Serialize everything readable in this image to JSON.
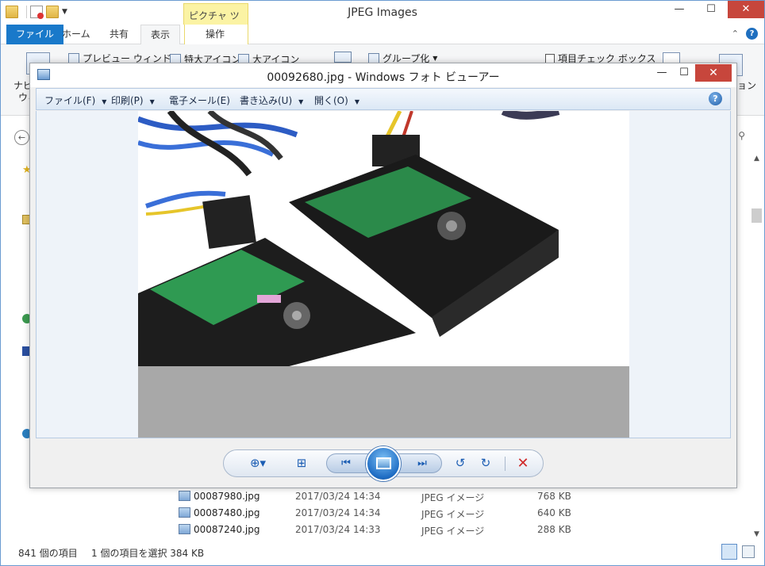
{
  "explorer": {
    "title": "JPEG Images",
    "picture_tools_label": "ピクチャ ツール",
    "window_controls": {
      "minimize": "—",
      "maximize": "☐",
      "close": "✕"
    },
    "tabs": {
      "file": "ファイル",
      "home": "ホーム",
      "share": "共有",
      "view": "表示",
      "manage": "操作"
    },
    "ribbon": {
      "nav_pane_line1": "ナビ",
      "nav_pane_line2": "ウィ",
      "preview_pane": "プレビュー ウィンドウ",
      "extra_large_icons": "特大アイコン",
      "large_icons": "大アイコン",
      "group_by": "グループ化",
      "item_check_boxes": "項目チェック ボックス",
      "options_partial": "ョン"
    },
    "files": [
      {
        "name": "00087980.jpg",
        "date": "2017/03/24 14:34",
        "type": "JPEG イメージ",
        "size": "768 KB"
      },
      {
        "name": "00087480.jpg",
        "date": "2017/03/24 14:34",
        "type": "JPEG イメージ",
        "size": "640 KB"
      },
      {
        "name": "00087240.jpg",
        "date": "2017/03/24 14:33",
        "type": "JPEG イメージ",
        "size": "288 KB"
      }
    ],
    "status": {
      "item_count": "841 個の項目",
      "selection": "1 個の項目を選択  384 KB"
    }
  },
  "viewer": {
    "title": "00092680.jpg - Windows フォト ビューアー",
    "window_controls": {
      "minimize": "—",
      "maximize": "☐",
      "close": "✕"
    },
    "menu": {
      "file": "ファイル(F)",
      "print": "印刷(P)",
      "email": "電子メール(E)",
      "burn": "書き込み(U)",
      "open": "開く(O)"
    },
    "help": "?",
    "colors": {
      "close_red": "#c7463c",
      "accent_blue": "#1b5db3",
      "delete_red": "#d02a2a",
      "canvas_bg": "#eef3f9",
      "letterbox_gray": "#a8a8a8"
    },
    "controls": {
      "zoom": "zoom-icon",
      "fit": "actual-size-icon",
      "prev": "previous-icon",
      "slideshow": "slideshow-icon",
      "next": "next-icon",
      "rotate_left": "rotate-counterclockwise-icon",
      "rotate_right": "rotate-clockwise-icon",
      "delete": "delete-icon"
    }
  }
}
